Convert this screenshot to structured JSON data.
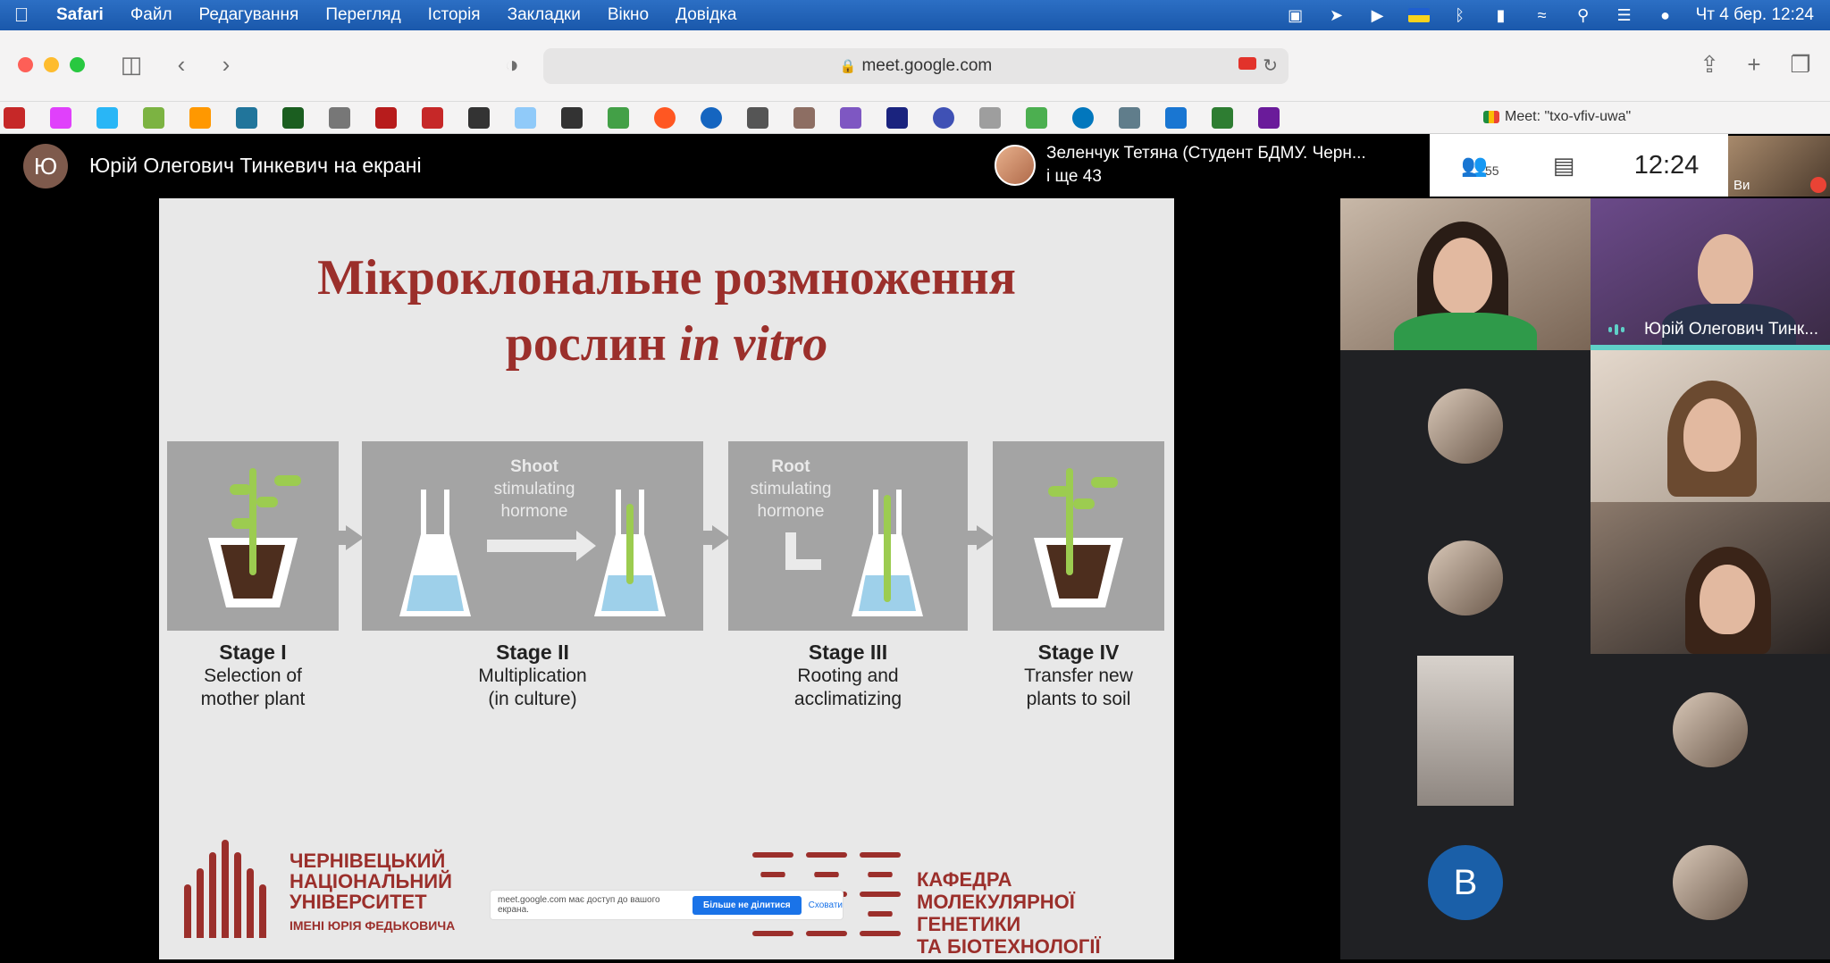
{
  "menubar": {
    "app": "Safari",
    "items": [
      "Файл",
      "Редагування",
      "Перегляд",
      "Історія",
      "Закладки",
      "Вікно",
      "Довідка"
    ],
    "clock": "Чт 4 бер.  12:24"
  },
  "browser": {
    "url": "meet.google.com",
    "tab_title": "Meet: \"txo-vfiv-uwa\""
  },
  "meet": {
    "presenter_initial": "Ю",
    "presenter_text": "Юрій Олегович Тинкевич на екрані",
    "participants_name": "Зеленчук Тетяна (Студент БДМУ. Черн...",
    "participants_more": "і ще 43",
    "participant_count": "55",
    "time": "12:24",
    "self_label": "Ви"
  },
  "slide": {
    "title_line1": "Мікроклональне розмноження",
    "title_line2_plain": "рослин ",
    "title_line2_italic": "in vitro",
    "hormone_shoot": {
      "title": "Shoot",
      "line1": "stimulating",
      "line2": "hormone"
    },
    "hormone_root": {
      "title": "Root",
      "line1": "stimulating",
      "line2": "hormone"
    },
    "stages": [
      {
        "title": "Stage I",
        "line1": "Selection of",
        "line2": "mother plant"
      },
      {
        "title": "Stage II",
        "line1": "Multiplication",
        "line2": "(in culture)"
      },
      {
        "title": "Stage III",
        "line1": "Rooting and",
        "line2": "acclimatizing"
      },
      {
        "title": "Stage IV",
        "line1": "Transfer new",
        "line2": "plants to soil"
      }
    ],
    "university": {
      "line1": "ЧЕРНІВЕЦЬКИЙ",
      "line2": "НАЦІОНАЛЬНИЙ",
      "line3": "УНІВЕРСИТЕТ",
      "line4": "ІМЕНІ ЮРІЯ ФЕДЬКОВИЧА"
    },
    "department": {
      "line1": "КАФЕДРА",
      "line2": "МОЛЕКУЛЯРНОЇ ГЕНЕТИКИ",
      "line3": "ТА БІОТЕХНОЛОГІЇ"
    },
    "share_notice": {
      "text": "meet.google.com має доступ до вашого екрана.",
      "stop": "Більше не ділитися",
      "hide": "Сховати"
    }
  },
  "grid": {
    "speaker_name": "Юрій Олегович Тинк...",
    "letter_tile": "В"
  },
  "colors": {
    "accent_red": "#9b2f2b",
    "speaking": "#5fd0c8",
    "menubar": "#1d5fb4"
  }
}
